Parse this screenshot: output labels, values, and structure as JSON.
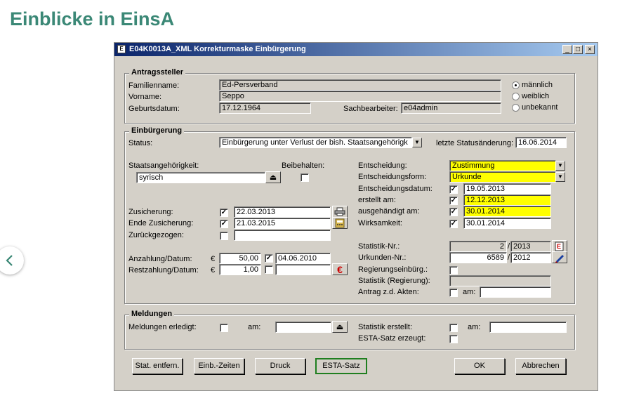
{
  "page": {
    "title": "Einblicke in EinsA"
  },
  "window": {
    "title": "E04K0013A_XML Korrekturmaske Einbürgerung",
    "icon_text": "E"
  },
  "antragsteller": {
    "legend": "Antragssteller",
    "familienname_label": "Familienname:",
    "familienname": "Ed-Persverband",
    "vorname_label": "Vorname:",
    "vorname": "Seppo",
    "geburtsdatum_label": "Geburtsdatum:",
    "geburtsdatum": "17.12.1964",
    "sachbearbeiter_label": "Sachbearbeiter:",
    "sachbearbeiter": "e04admin",
    "gender_options": [
      "männlich",
      "weiblich",
      "unbekannt"
    ],
    "gender_selected": "männlich"
  },
  "einbuergerung": {
    "legend": "Einbürgerung",
    "status_label": "Status:",
    "status": "Einbürgerung unter Verlust der bish. Staatsangehörigk",
    "statusaenderung_label": "letzte Statusänderung:",
    "statusaenderung": "16.06.2014",
    "staatsangehoerigkeit_label": "Staatsangehörigkeit:",
    "staatsangehoerigkeit": "syrisch",
    "beibehalten_label": "Beibehalten:",
    "entscheidung_label": "Entscheidung:",
    "entscheidung": "Zustimmung",
    "entscheidungsform_label": "Entscheidungsform:",
    "entscheidungsform": "Urkunde",
    "entscheidungsdatum_label": "Entscheidungsdatum:",
    "entscheidungsdatum": "19.05.2013",
    "erstellt_label": "erstellt am:",
    "erstellt": "12.12.2013",
    "ausgehaendigt_label": "ausgehändigt am:",
    "ausgehaendigt": "30.01.2014",
    "wirksamkeit_label": "Wirksamkeit:",
    "wirksamkeit": "30.01.2014",
    "zusicherung_label": "Zusicherung:",
    "zusicherung": "22.03.2013",
    "ende_zusicherung_label": "Ende Zusicherung:",
    "ende_zusicherung": "21.03.2015",
    "zurueckgezogen_label": "Zurückgezogen:",
    "anzahlung_label": "Anzahlung/Datum:",
    "anzahlung": "50,00",
    "anzahlung_datum": "04.06.2010",
    "restzahlung_label": "Restzahlung/Datum:",
    "restzahlung": "1,00",
    "currency": "€",
    "statistik_nr_label": "Statistik-Nr.:",
    "statistik_nr": "2",
    "statistik_jahr": "2013",
    "urkunden_nr_label": "Urkunden-Nr.:",
    "urkunden_nr": "6589",
    "urkunden_jahr": "2012",
    "slash": "/",
    "regierungseinbuerg_label": "Regierungseinbürg.:",
    "statistik_regierung_label": "Statistik (Regierung):",
    "antrag_akten_label": "Antrag z.d. Akten:",
    "am_label": "am:"
  },
  "meldungen": {
    "legend": "Meldungen",
    "erledigt_label": "Meldungen erledigt:",
    "am_label": "am:",
    "statistik_erstellt_label": "Statistik erstellt:",
    "esta_label": "ESTA-Satz erzeugt:"
  },
  "buttons": {
    "stat_entfern": "Stat. entfern.",
    "einb_zeiten": "Einb.-Zeiten",
    "druck": "Druck",
    "esta_satz": "ESTA-Satz",
    "ok": "OK",
    "abbrechen": "Abbrechen"
  },
  "colors": {
    "title_green": "#3b8876",
    "highlight_yellow": "#ffff00",
    "focus_green": "#1f7f1f",
    "euro_red": "#cc0000"
  },
  "icons": [
    "chevron-left-icon",
    "printer-icon",
    "calculator-icon",
    "euro-icon",
    "report-icon",
    "pen-icon",
    "eject-icon",
    "dropdown-arrow-icon"
  ]
}
